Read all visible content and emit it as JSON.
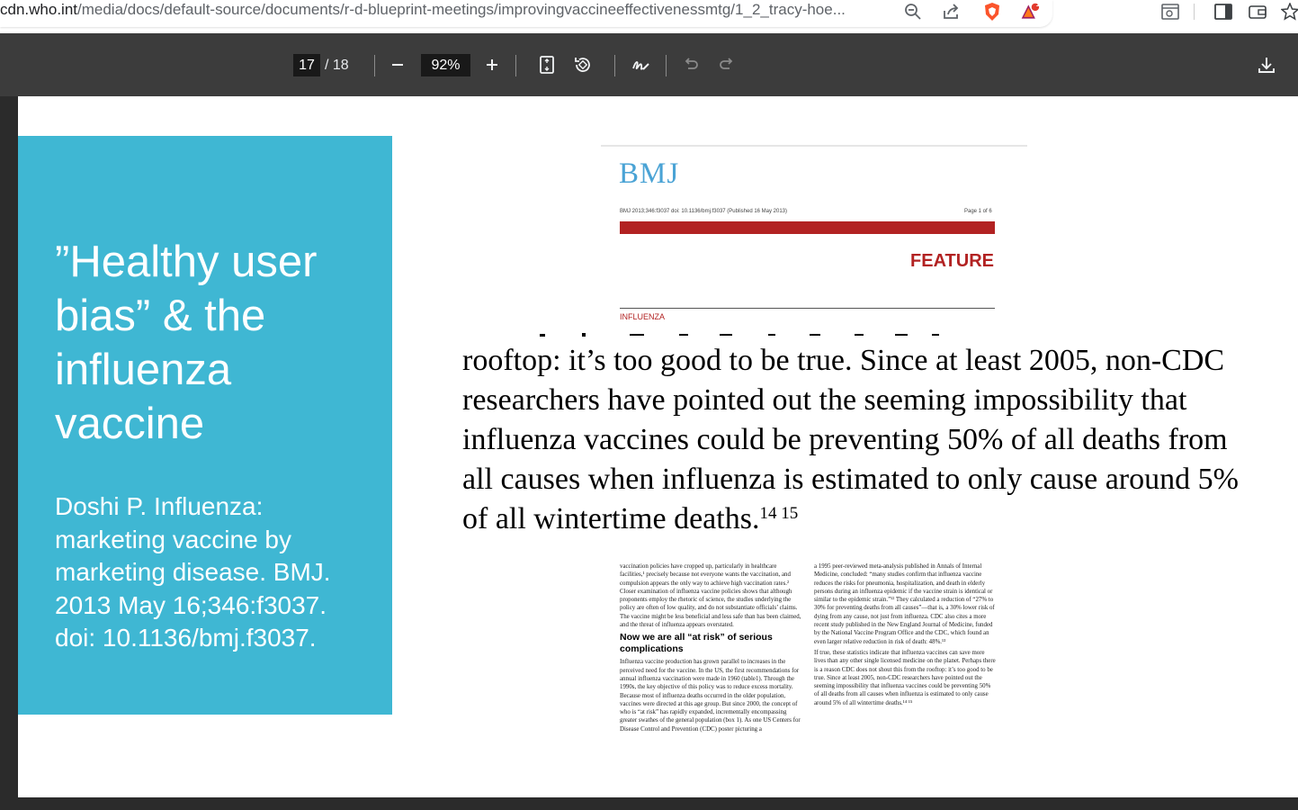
{
  "browser": {
    "url_host": "cdn.who.int",
    "url_path": "/media/docs/default-source/documents/r-d-blueprint-meetings/improvingvaccineeffectivenessmtg/1_2_tracy-hoe...",
    "extension_badge": "1"
  },
  "pdf_toolbar": {
    "current_page": "17",
    "page_separator": "/ 18",
    "zoom": "92%"
  },
  "slide": {
    "title": "”Healthy user bias” & the influenza vaccine",
    "citation": "Doshi P. Influenza: marketing vaccine by marketing disease. BMJ. 2013 May 16;346:f3037. doi: 10.1136/bmj.f3037."
  },
  "bmj_header": {
    "logo": "BMJ",
    "meta": "BMJ 2013;346:f3037 doi: 10.1136/bmj.f3037 (Published 16 May 2013)",
    "page": "Page 1 of 6",
    "feature": "FEATURE",
    "section": "INFLUENZA"
  },
  "quote": {
    "line1": "rooftop: it’s too good to be true. Since at least 2005, non-CDC",
    "line2": "researchers have pointed out the seeming impossibility that",
    "line3": "influenza vaccines could be preventing 50% of all deaths from",
    "line4": "all causes when influenza is estimated to only cause around 5%",
    "line5": "of all wintertime deaths.",
    "refs": "14 15"
  },
  "article": {
    "left_p1": "vaccination policies have cropped up, particularly in healthcare facilities,¹ precisely because not everyone wants the vaccination, and compulsion appears the only way to achieve high vaccination rates.² Closer examination of influenza vaccine policies shows that although proponents employ the rhetoric of science, the studies underlying the policy are often of low quality, and do not substantiate officials’ claims. The vaccine might be less beneficial and less safe than has been claimed, and the threat of influenza appears overstated.",
    "left_heading": "Now we are all “at risk” of serious complications",
    "left_p2": "Influenza vaccine production has grown parallel to increases in the perceived need for the vaccine. In the US, the first recommendations for annual influenza vaccination were made in 1960 (table1). Through the 1990s, the key objective of this policy was to reduce excess mortality. Because most of influenza deaths occurred in the older population, vaccines were directed at this age group. But since 2000, the concept of who is “at risk” has rapidly expanded, incrementally encompassing greater swathes of the general population (box 1). As one US Centers for Disease Control and Prevention (CDC) poster picturing a",
    "right_p1": "a 1995 peer-reviewed meta-analysis published in Annals of Internal Medicine, concluded: “many studies confirm that influenza vaccine reduces the risks for pneumonia, hospitalization, and death in elderly persons during an influenza epidemic if the vaccine strain is identical or similar to the epidemic strain.”¹² They calculated a reduction of “27% to 30% for preventing deaths from all causes”—that is, a 30% lower risk of dying from any cause, not just from influenza. CDC also cites a more recent study published in the New England Journal of Medicine, funded by the National Vaccine Program Office and the CDC, which found an even larger relative reduction in risk of death: 48%.¹³",
    "right_p2": "If true, these statistics indicate that influenza vaccines can save more lives than any other single licensed medicine on the planet. Perhaps there is a reason CDC does not shout this from the rooftop: it’s too good to be true. Since at least 2005, non-CDC researchers have pointed out the seeming impossibility that influenza vaccines could be preventing 50% of all deaths from all causes when influenza is estimated to only cause around 5% of all wintertime deaths.¹⁴ ¹⁵"
  },
  "colors": {
    "slide_blue": "#3fb7d3",
    "bmj_red": "#b22222",
    "bmj_blue": "#4aa3d5",
    "toolbar": "#3c3c3c"
  }
}
